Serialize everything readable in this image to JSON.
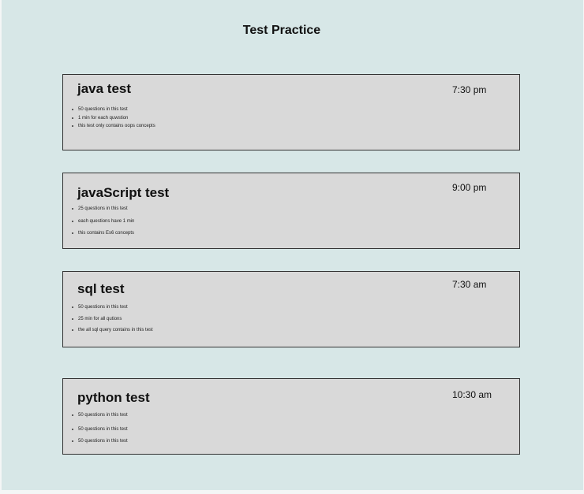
{
  "page": {
    "title": "Test Practice"
  },
  "tests": [
    {
      "title": "java test",
      "time": "7:30 pm",
      "bullets": [
        "50 questions in this test",
        "1 min for each quwstion",
        "this test only contains oops concepts"
      ]
    },
    {
      "title": "javaScript test",
      "time": "9:00 pm",
      "bullets": [
        "25 questions in this test",
        "each questions have 1 min",
        "this contains Es6 concepts"
      ]
    },
    {
      "title": "sql test",
      "time": "7:30 am",
      "bullets": [
        "50 questions in this test",
        "25 min for all qutions",
        "the all sql query contains in this test"
      ]
    },
    {
      "title": "python test",
      "time": "10:30 am",
      "bullets": [
        "50 questions in this test",
        "50 questions in this test",
        "50 questions in this test"
      ]
    }
  ],
  "colors": {
    "page_background": "#d7e7e7",
    "card_background": "#d9d9d9",
    "card_border": "#333333"
  }
}
